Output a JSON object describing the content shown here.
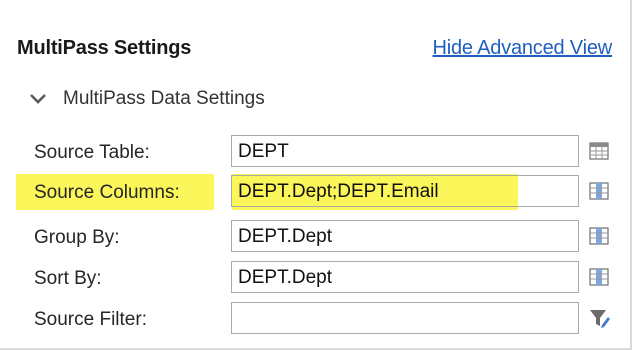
{
  "header": {
    "title": "MultiPass Settings",
    "link": "Hide Advanced View"
  },
  "section": {
    "title": "MultiPass Data Settings"
  },
  "rows": [
    {
      "label": "Source Table:",
      "value": "DEPT",
      "button_icon": "table-grid-icon"
    },
    {
      "label": "Source Columns:",
      "value": "DEPT.Dept;DEPT.Email",
      "button_icon": "column-picker-icon"
    },
    {
      "label": "Group By:",
      "value": "DEPT.Dept",
      "button_icon": "column-picker-icon"
    },
    {
      "label": "Sort By:",
      "value": "DEPT.Dept",
      "button_icon": "column-picker-icon"
    },
    {
      "label": "Source Filter:",
      "value": "",
      "button_icon": "filter-edit-icon"
    }
  ],
  "colors": {
    "highlight": "#fbf65a",
    "link": "#1f5fbf"
  }
}
